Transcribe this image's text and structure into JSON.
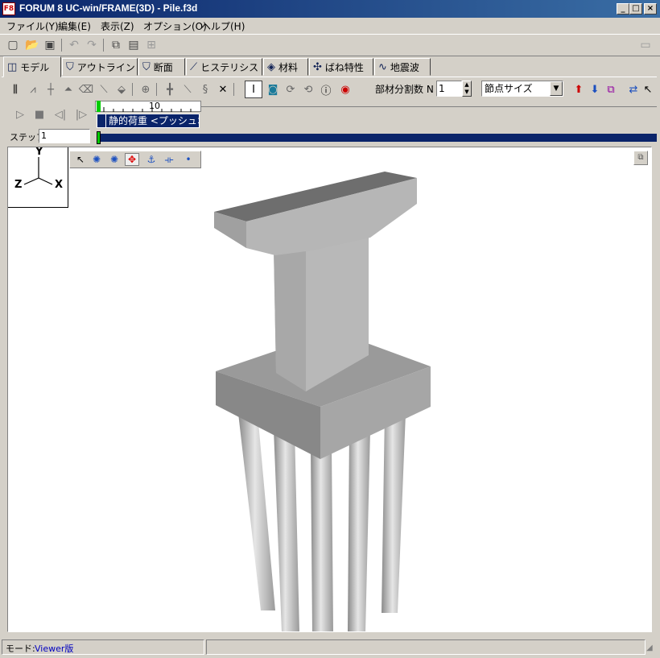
{
  "window": {
    "title": "FORUM 8   UC-win/FRAME(3D) - Pile.f3d",
    "app_icon": "F8",
    "min_glyph": "_",
    "max_glyph": "□",
    "close_glyph": "×"
  },
  "menu": [
    "ファイル(Y)",
    "編集(E)",
    "表示(Z)",
    "オプション(O)",
    "ヘルプ(H)"
  ],
  "tabs": [
    {
      "label": "モデル",
      "icon": "model-icon",
      "active": true
    },
    {
      "label": "アウトライン",
      "icon": "outline-icon"
    },
    {
      "label": "断面",
      "icon": "section-icon"
    },
    {
      "label": "ヒステリシス",
      "icon": "hysteresis-icon"
    },
    {
      "label": "材料",
      "icon": "material-icon"
    },
    {
      "label": "ばね特性",
      "icon": "spring-icon"
    },
    {
      "label": "地震波",
      "icon": "wave-icon"
    }
  ],
  "toolbar2": {
    "division_label": "部材分割数 N",
    "division_value": "1",
    "node_size_value": "節点サイズ"
  },
  "animation": {
    "step_label": "ステップ",
    "step_value": "1",
    "ruler_mark": "10",
    "case_label": "静的荷重 <プッシュオ"
  },
  "axes": {
    "y": "Y",
    "z": "Z",
    "x": "X"
  },
  "statusbar": {
    "mode_label": "モード:",
    "mode_value": "Viewer版"
  },
  "colors": {
    "titlebar": "#0a246a",
    "face": "#d4d0c8",
    "progress": "#0a246a",
    "slider_marker": "#00cc00",
    "status_value": "#0000c0"
  }
}
